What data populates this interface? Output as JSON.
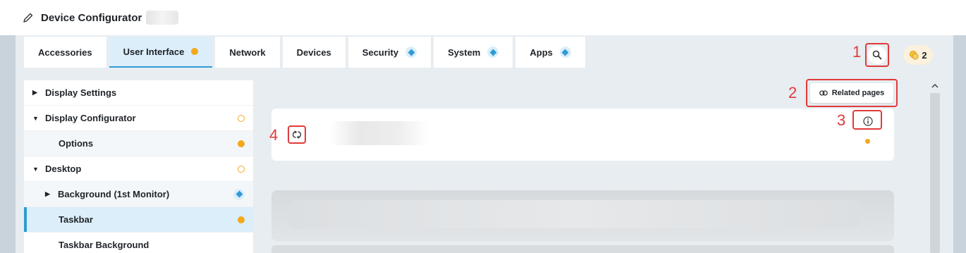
{
  "window": {
    "title": "Device Configurator"
  },
  "tabs": [
    {
      "label": "Accessories",
      "marker": "none"
    },
    {
      "label": "User Interface",
      "marker": "dot"
    },
    {
      "label": "Network",
      "marker": "none"
    },
    {
      "label": "Devices",
      "marker": "none"
    },
    {
      "label": "Security",
      "marker": "diamond"
    },
    {
      "label": "System",
      "marker": "diamond"
    },
    {
      "label": "Apps",
      "marker": "diamond"
    }
  ],
  "active_tab": "User Interface",
  "toolbar": {
    "badge_count": "2"
  },
  "annotations": {
    "search": "1",
    "related": "2",
    "info": "3",
    "reset": "4"
  },
  "sidebar": {
    "items": [
      {
        "label": "Display Settings",
        "arrow": "right",
        "marker": "none"
      },
      {
        "label": "Display Configurator",
        "arrow": "down",
        "marker": "ring"
      },
      {
        "label": "Options",
        "arrow": "none",
        "marker": "dot"
      },
      {
        "label": "Desktop",
        "arrow": "down",
        "marker": "ring"
      },
      {
        "label": "Background (1st Monitor)",
        "arrow": "right",
        "marker": "diamond"
      },
      {
        "label": "Taskbar",
        "arrow": "none",
        "marker": "dot",
        "selected": true
      },
      {
        "label": "Taskbar Background",
        "arrow": "none",
        "marker": "none"
      }
    ]
  },
  "content": {
    "related_pages_label": "Related pages"
  },
  "colors": {
    "accent": "#2e9bd6",
    "modified": "#f4a81c",
    "annotation": "#e03a3a"
  },
  "icons": [
    "pencil-icon",
    "search-icon",
    "coin-icon",
    "link-icon",
    "reset-icon",
    "info-icon",
    "chevron-up-icon"
  ]
}
